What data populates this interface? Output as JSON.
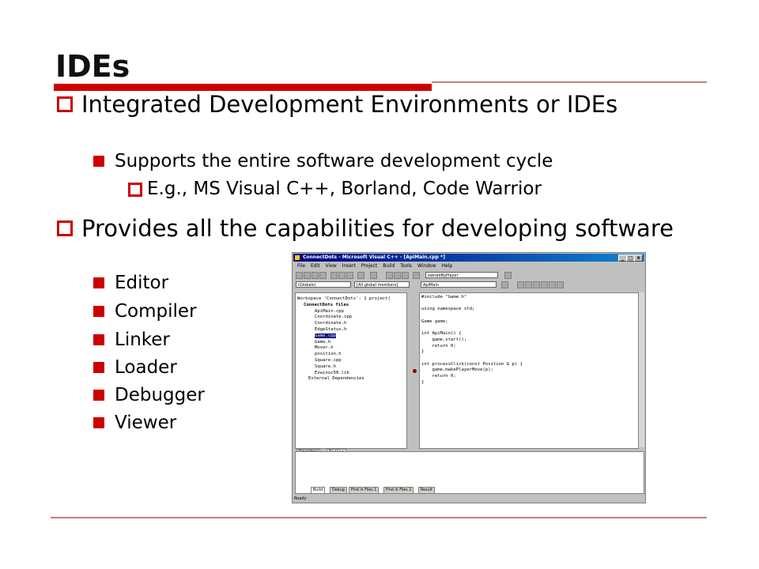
{
  "slide": {
    "title": "IDEs",
    "bullets": [
      {
        "text": "Integrated Development Environments or IDEs"
      },
      {
        "text": "Supports the entire software development cycle"
      },
      {
        "text": "E.g., MS Visual C++, Borland, Code Warrior"
      },
      {
        "text": "Provides all the capabilities for developing software"
      }
    ],
    "capabilities": [
      "Editor",
      "Compiler",
      "Linker",
      "Loader",
      "Debugger",
      "Viewer"
    ]
  },
  "ide": {
    "window_title": "ConnectDots - Microsoft Visual C++ - [ApiMain.cpp *]",
    "window_buttons": [
      "_",
      "□",
      "x"
    ],
    "menu": [
      "File",
      "Edit",
      "View",
      "Insert",
      "Project",
      "Build",
      "Tools",
      "Window",
      "Help"
    ],
    "toolbar_combo_1": "ownedByPlayer",
    "toolbar_combo_2": "(Globals)",
    "toolbar_combo_3": "[All global members]",
    "toolbar_combo_4": "ApiMain",
    "tree": [
      "Workspace 'ConnectDots': 1 project(",
      "ConnectDots files",
      "ApiMain.cpp",
      "Coordinate.cpp",
      "Coordinate.h",
      "EdgeStatus.h",
      "Game.cpp",
      "Game.h",
      "Mover.h",
      "position.h",
      "Square.cpp",
      "Square.h",
      "Ezwinvc50.lib",
      "External Dependencies"
    ],
    "pane_tabs": [
      "ClassView",
      "FileView"
    ],
    "code": [
      "#include \"Game.h\"",
      "",
      "using namespace std;",
      "",
      "Game game;",
      "",
      "int ApiMain() {",
      "    game.start();",
      "    return 0;",
      "}",
      "",
      "int processClick(const Position & p) {",
      "    game.makePlayerMove(p);",
      "    return 0;",
      "}"
    ],
    "output_tabs": [
      "Build",
      "Debug",
      "Find in Files 1",
      "Find in Files 2",
      "Result"
    ],
    "status": "Ready",
    "colors": {
      "titlebar": "#000080",
      "selection": "#000080",
      "breakpoint": "#900000"
    }
  },
  "colors": {
    "accent": "#cc0000",
    "rule": "#c87c7c"
  }
}
